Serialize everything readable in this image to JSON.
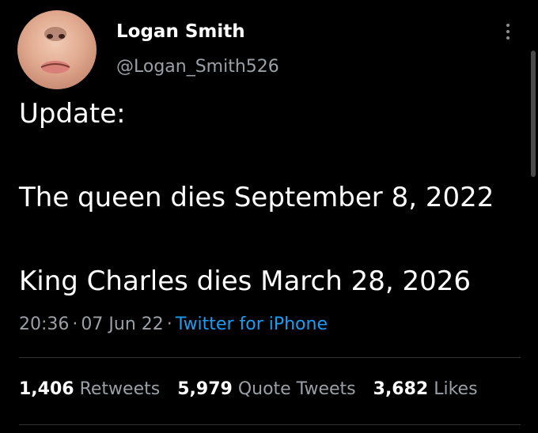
{
  "user": {
    "display_name": "Logan Smith",
    "handle": "@Logan_Smith526",
    "avatar_icon": "profile-photo"
  },
  "tweet": {
    "lines": [
      "Update:",
      "The queen dies September 8, 2022",
      "King Charles dies March 28, 2026"
    ],
    "time": "20:36",
    "date": "07 Jun 22",
    "separator": "·",
    "source": "Twitter for iPhone"
  },
  "stats": {
    "retweets_count": "1,406",
    "retweets_label": "Retweets",
    "quotes_count": "5,979",
    "quotes_label": "Quote Tweets",
    "likes_count": "3,682",
    "likes_label": "Likes"
  },
  "colors": {
    "background": "#000000",
    "primary_text": "#ffffff",
    "secondary_text": "#9aa0a6",
    "link": "#1d9bf0",
    "divider": "#2f3336"
  }
}
